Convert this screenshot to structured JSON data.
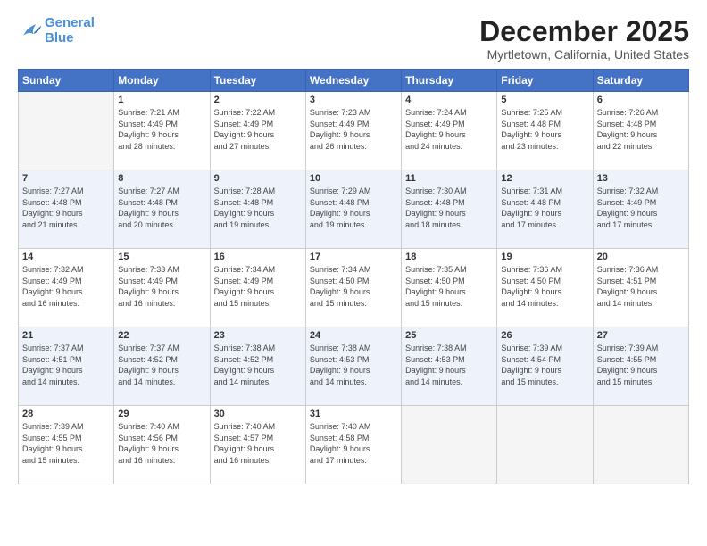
{
  "logo": {
    "line1": "General",
    "line2": "Blue"
  },
  "title": "December 2025",
  "subtitle": "Myrtletown, California, United States",
  "weekdays": [
    "Sunday",
    "Monday",
    "Tuesday",
    "Wednesday",
    "Thursday",
    "Friday",
    "Saturday"
  ],
  "weeks": [
    [
      {
        "day": "",
        "info": ""
      },
      {
        "day": "1",
        "info": "Sunrise: 7:21 AM\nSunset: 4:49 PM\nDaylight: 9 hours\nand 28 minutes."
      },
      {
        "day": "2",
        "info": "Sunrise: 7:22 AM\nSunset: 4:49 PM\nDaylight: 9 hours\nand 27 minutes."
      },
      {
        "day": "3",
        "info": "Sunrise: 7:23 AM\nSunset: 4:49 PM\nDaylight: 9 hours\nand 26 minutes."
      },
      {
        "day": "4",
        "info": "Sunrise: 7:24 AM\nSunset: 4:49 PM\nDaylight: 9 hours\nand 24 minutes."
      },
      {
        "day": "5",
        "info": "Sunrise: 7:25 AM\nSunset: 4:48 PM\nDaylight: 9 hours\nand 23 minutes."
      },
      {
        "day": "6",
        "info": "Sunrise: 7:26 AM\nSunset: 4:48 PM\nDaylight: 9 hours\nand 22 minutes."
      }
    ],
    [
      {
        "day": "7",
        "info": "Sunrise: 7:27 AM\nSunset: 4:48 PM\nDaylight: 9 hours\nand 21 minutes."
      },
      {
        "day": "8",
        "info": "Sunrise: 7:27 AM\nSunset: 4:48 PM\nDaylight: 9 hours\nand 20 minutes."
      },
      {
        "day": "9",
        "info": "Sunrise: 7:28 AM\nSunset: 4:48 PM\nDaylight: 9 hours\nand 19 minutes."
      },
      {
        "day": "10",
        "info": "Sunrise: 7:29 AM\nSunset: 4:48 PM\nDaylight: 9 hours\nand 19 minutes."
      },
      {
        "day": "11",
        "info": "Sunrise: 7:30 AM\nSunset: 4:48 PM\nDaylight: 9 hours\nand 18 minutes."
      },
      {
        "day": "12",
        "info": "Sunrise: 7:31 AM\nSunset: 4:48 PM\nDaylight: 9 hours\nand 17 minutes."
      },
      {
        "day": "13",
        "info": "Sunrise: 7:32 AM\nSunset: 4:49 PM\nDaylight: 9 hours\nand 17 minutes."
      }
    ],
    [
      {
        "day": "14",
        "info": "Sunrise: 7:32 AM\nSunset: 4:49 PM\nDaylight: 9 hours\nand 16 minutes."
      },
      {
        "day": "15",
        "info": "Sunrise: 7:33 AM\nSunset: 4:49 PM\nDaylight: 9 hours\nand 16 minutes."
      },
      {
        "day": "16",
        "info": "Sunrise: 7:34 AM\nSunset: 4:49 PM\nDaylight: 9 hours\nand 15 minutes."
      },
      {
        "day": "17",
        "info": "Sunrise: 7:34 AM\nSunset: 4:50 PM\nDaylight: 9 hours\nand 15 minutes."
      },
      {
        "day": "18",
        "info": "Sunrise: 7:35 AM\nSunset: 4:50 PM\nDaylight: 9 hours\nand 15 minutes."
      },
      {
        "day": "19",
        "info": "Sunrise: 7:36 AM\nSunset: 4:50 PM\nDaylight: 9 hours\nand 14 minutes."
      },
      {
        "day": "20",
        "info": "Sunrise: 7:36 AM\nSunset: 4:51 PM\nDaylight: 9 hours\nand 14 minutes."
      }
    ],
    [
      {
        "day": "21",
        "info": "Sunrise: 7:37 AM\nSunset: 4:51 PM\nDaylight: 9 hours\nand 14 minutes."
      },
      {
        "day": "22",
        "info": "Sunrise: 7:37 AM\nSunset: 4:52 PM\nDaylight: 9 hours\nand 14 minutes."
      },
      {
        "day": "23",
        "info": "Sunrise: 7:38 AM\nSunset: 4:52 PM\nDaylight: 9 hours\nand 14 minutes."
      },
      {
        "day": "24",
        "info": "Sunrise: 7:38 AM\nSunset: 4:53 PM\nDaylight: 9 hours\nand 14 minutes."
      },
      {
        "day": "25",
        "info": "Sunrise: 7:38 AM\nSunset: 4:53 PM\nDaylight: 9 hours\nand 14 minutes."
      },
      {
        "day": "26",
        "info": "Sunrise: 7:39 AM\nSunset: 4:54 PM\nDaylight: 9 hours\nand 15 minutes."
      },
      {
        "day": "27",
        "info": "Sunrise: 7:39 AM\nSunset: 4:55 PM\nDaylight: 9 hours\nand 15 minutes."
      }
    ],
    [
      {
        "day": "28",
        "info": "Sunrise: 7:39 AM\nSunset: 4:55 PM\nDaylight: 9 hours\nand 15 minutes."
      },
      {
        "day": "29",
        "info": "Sunrise: 7:40 AM\nSunset: 4:56 PM\nDaylight: 9 hours\nand 16 minutes."
      },
      {
        "day": "30",
        "info": "Sunrise: 7:40 AM\nSunset: 4:57 PM\nDaylight: 9 hours\nand 16 minutes."
      },
      {
        "day": "31",
        "info": "Sunrise: 7:40 AM\nSunset: 4:58 PM\nDaylight: 9 hours\nand 17 minutes."
      },
      {
        "day": "",
        "info": ""
      },
      {
        "day": "",
        "info": ""
      },
      {
        "day": "",
        "info": ""
      }
    ]
  ]
}
